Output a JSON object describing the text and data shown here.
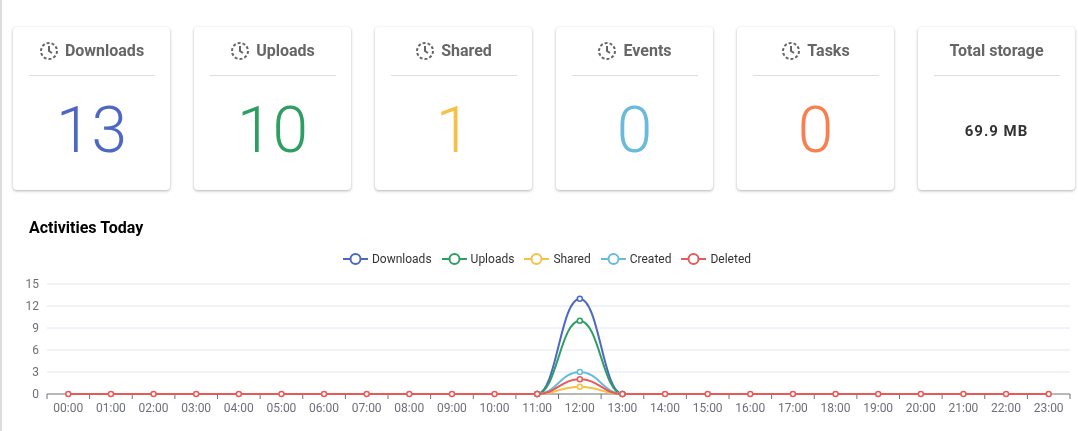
{
  "cards": [
    {
      "kind": "counter",
      "title": "Downloads",
      "value": "13",
      "color": "#4d68c4"
    },
    {
      "kind": "counter",
      "title": "Uploads",
      "value": "10",
      "color": "#2e9e63"
    },
    {
      "kind": "counter",
      "title": "Shared",
      "value": "1",
      "color": "#f6c146"
    },
    {
      "kind": "counter",
      "title": "Events",
      "value": "0",
      "color": "#6abbdb"
    },
    {
      "kind": "counter",
      "title": "Tasks",
      "value": "0",
      "color": "#fb7e4f"
    },
    {
      "kind": "storage",
      "title": "Total storage",
      "value": "69.9 MB"
    }
  ],
  "activity": {
    "title": "Activities Today",
    "chart_data": {
      "type": "line",
      "grid": true,
      "categories": [
        "00:00",
        "01:00",
        "02:00",
        "03:00",
        "04:00",
        "05:00",
        "06:00",
        "07:00",
        "08:00",
        "09:00",
        "10:00",
        "11:00",
        "12:00",
        "13:00",
        "14:00",
        "15:00",
        "16:00",
        "17:00",
        "18:00",
        "19:00",
        "20:00",
        "21:00",
        "22:00",
        "23:00"
      ],
      "ylim": [
        0,
        15
      ],
      "yticks": [
        0,
        3,
        6,
        9,
        12,
        15
      ],
      "series": [
        {
          "name": "Downloads",
          "color": "#4d68c4",
          "marker": true,
          "values": [
            null,
            null,
            null,
            null,
            null,
            null,
            null,
            null,
            null,
            null,
            null,
            0,
            13,
            0,
            null,
            null,
            null,
            null,
            null,
            null,
            null,
            null,
            null,
            null
          ]
        },
        {
          "name": "Uploads",
          "color": "#2e9e63",
          "marker": true,
          "values": [
            null,
            null,
            null,
            null,
            null,
            null,
            null,
            null,
            null,
            null,
            null,
            0,
            10,
            0,
            null,
            null,
            null,
            null,
            null,
            null,
            null,
            null,
            null,
            null
          ]
        },
        {
          "name": "Shared",
          "color": "#f6c146",
          "marker": true,
          "values": [
            null,
            null,
            null,
            null,
            null,
            null,
            null,
            null,
            null,
            null,
            null,
            0,
            1,
            0,
            null,
            null,
            null,
            null,
            null,
            null,
            null,
            null,
            null,
            null
          ]
        },
        {
          "name": "Created",
          "color": "#6abbdb",
          "marker": true,
          "values": [
            null,
            null,
            null,
            null,
            null,
            null,
            null,
            null,
            null,
            null,
            null,
            0,
            3,
            0,
            null,
            null,
            null,
            null,
            null,
            null,
            null,
            null,
            null,
            null
          ]
        },
        {
          "name": "Deleted",
          "color": "#e85a5a",
          "marker": true,
          "values": [
            0,
            0,
            0,
            0,
            0,
            0,
            0,
            0,
            0,
            0,
            0,
            0,
            2,
            0,
            0,
            0,
            0,
            0,
            0,
            0,
            0,
            0,
            0,
            0
          ]
        }
      ]
    }
  }
}
